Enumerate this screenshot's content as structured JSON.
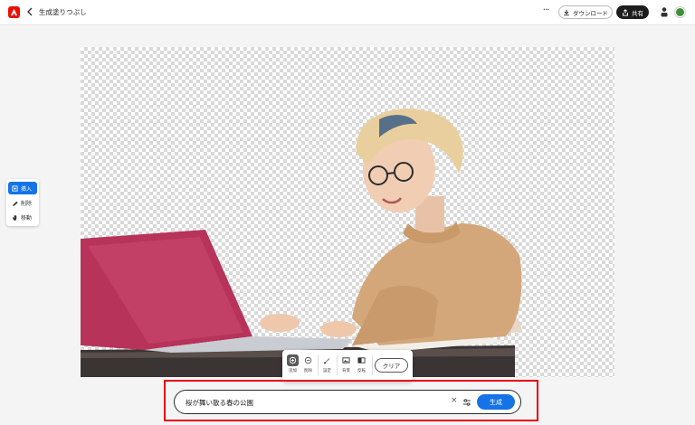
{
  "header": {
    "title": "生成塗りつぶし",
    "more_label": "···",
    "download_label": "ダウンロード",
    "share_label": "共有"
  },
  "side_tools": [
    {
      "label": "挿入",
      "icon": "insert-icon",
      "active": true
    },
    {
      "label": "削除",
      "icon": "remove-icon",
      "active": false
    },
    {
      "label": "移動",
      "icon": "pan-hand-icon",
      "active": false
    }
  ],
  "mask_toolbar": {
    "items": [
      {
        "label": "追加",
        "icon": "add-brush-icon"
      },
      {
        "label": "削除",
        "icon": "subtract-brush-icon"
      },
      {
        "label": "設定",
        "icon": "brush-settings-icon"
      },
      {
        "label": "背景",
        "icon": "background-icon"
      },
      {
        "label": "反転",
        "icon": "invert-icon"
      }
    ],
    "clear_label": "クリア"
  },
  "prompt": {
    "value": "桜が舞い散る春の公園",
    "clear_label": "×",
    "generate_label": "生成"
  },
  "colors": {
    "accent": "#1473e6",
    "brand": "#eb1000",
    "highlight_frame": "#e60012"
  }
}
